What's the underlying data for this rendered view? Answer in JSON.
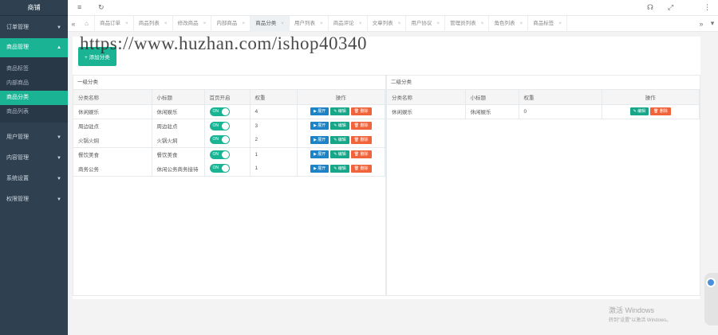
{
  "sidebar": {
    "brand": "商铺",
    "groups": [
      {
        "label": "订单管理",
        "caret": "▼"
      },
      {
        "label": "商品管理",
        "caret": "▲"
      },
      {
        "label": "用户管理",
        "caret": "▼"
      },
      {
        "label": "内容管理",
        "caret": "▼"
      },
      {
        "label": "系统设置",
        "caret": "▼"
      },
      {
        "label": "权限管理",
        "caret": "▼"
      }
    ],
    "subitems": [
      "商品标签",
      "内部商品",
      "商品分类",
      "商品列表"
    ]
  },
  "topbar": {
    "menu_icon": "≡",
    "refresh_icon": "↻",
    "icon_a": "☊",
    "icon_b": "⤢",
    "icon_c": "⋮"
  },
  "tabs": {
    "prev": "«",
    "next": "»",
    "dropdown": "▾",
    "home_icon": "⌂",
    "close": "×",
    "items": [
      "商品订单",
      "商品列表",
      "修改商品",
      "内部商品",
      "商品分类",
      "用户列表",
      "商品评论",
      "文章列表",
      "用户协议",
      "管理员列表",
      "角色列表",
      "商品标签"
    ]
  },
  "add_button": "+ 添加分类",
  "left_box": {
    "title": "一级分类",
    "headers": [
      "分类名称",
      "小标题",
      "首页开启",
      "权重",
      "操作"
    ],
    "rows": [
      {
        "name": "休闲娱乐",
        "subtitle": "休闲娱乐",
        "toggle": "ON",
        "weight": "4"
      },
      {
        "name": "周边驻点",
        "subtitle": "周边驻点",
        "toggle": "ON",
        "weight": "3"
      },
      {
        "name": "火锅火焖",
        "subtitle": "火锅火焖",
        "toggle": "ON",
        "weight": "2"
      },
      {
        "name": "餐饮美食",
        "subtitle": "餐饮美食",
        "toggle": "ON",
        "weight": "1"
      },
      {
        "name": "商务公务",
        "subtitle": "休闲公务商务接待",
        "toggle": "ON",
        "weight": "1"
      }
    ],
    "btn_view": "▶ 展开",
    "btn_edit": "✎ 编辑",
    "btn_del": "🗑 删除"
  },
  "right_box": {
    "title": "二级分类",
    "headers": [
      "分类名称",
      "小标题",
      "权重",
      "操作"
    ],
    "rows": [
      {
        "name": "休闲娱乐",
        "subtitle": "休闲娱乐",
        "weight": "0"
      }
    ],
    "btn_edit": "✎ 编辑",
    "btn_del": "🗑 删除"
  },
  "watermark": "https://www.huzhan.com/ishop40340",
  "windows": {
    "line1": "激活 Windows",
    "line2": "转到\"设置\"以激活 Windows。"
  }
}
